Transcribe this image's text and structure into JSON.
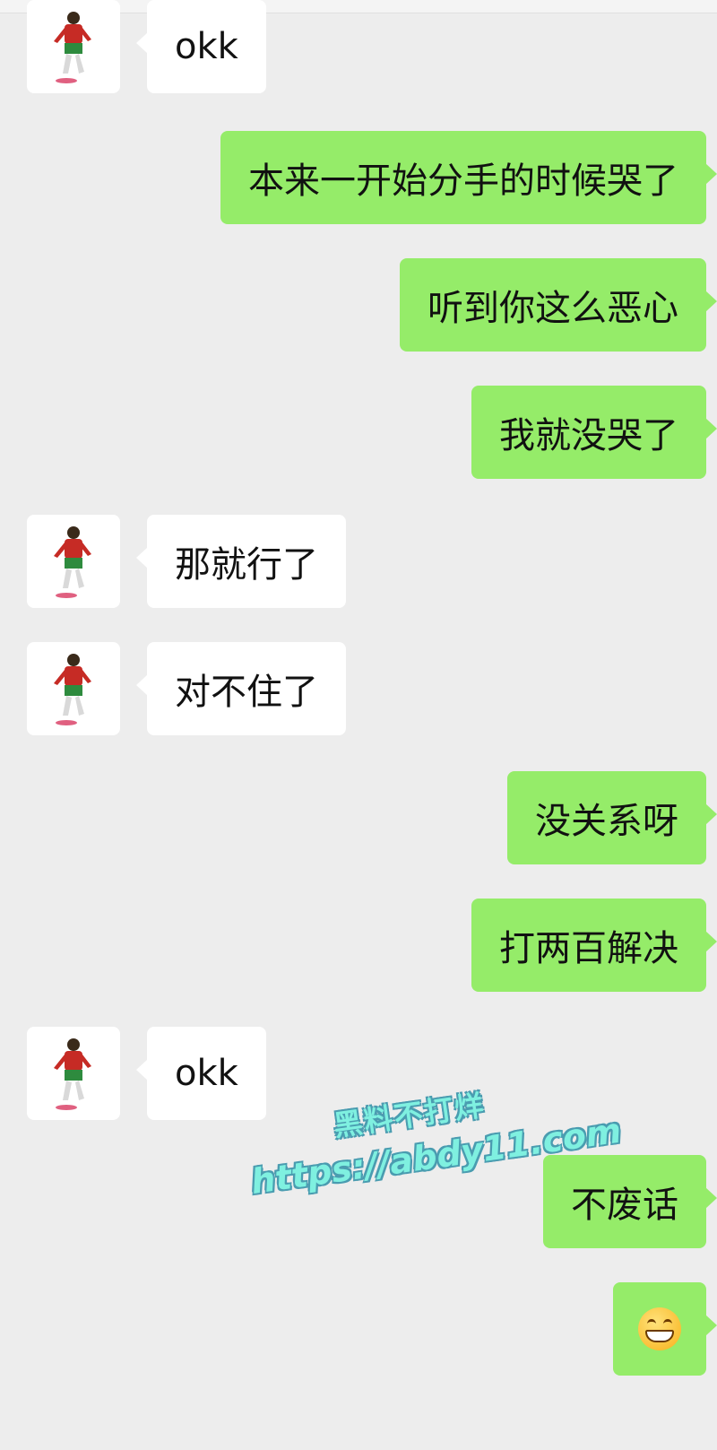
{
  "chat": {
    "messages": [
      {
        "side": "in",
        "text": "okk"
      },
      {
        "side": "out",
        "text": "本来一开始分手的时候哭了"
      },
      {
        "side": "out",
        "text": "听到你这么恶心"
      },
      {
        "side": "out",
        "text": "我就没哭了"
      },
      {
        "side": "in",
        "text": "那就行了"
      },
      {
        "side": "in",
        "text": "对不住了"
      },
      {
        "side": "out",
        "text": "没关系呀"
      },
      {
        "side": "out",
        "text": "打两百解决"
      },
      {
        "side": "in",
        "text": "okk"
      },
      {
        "side": "out",
        "text": "不废话"
      },
      {
        "side": "out",
        "emoji": "grinning-face-icon"
      }
    ]
  },
  "watermark": {
    "line1": "黑料不打烊",
    "line2": "https://abdy11.com"
  },
  "colors": {
    "background": "#ededed",
    "incoming": "#ffffff",
    "outgoing": "#95ec69",
    "watermark": "#7ff0e0"
  }
}
